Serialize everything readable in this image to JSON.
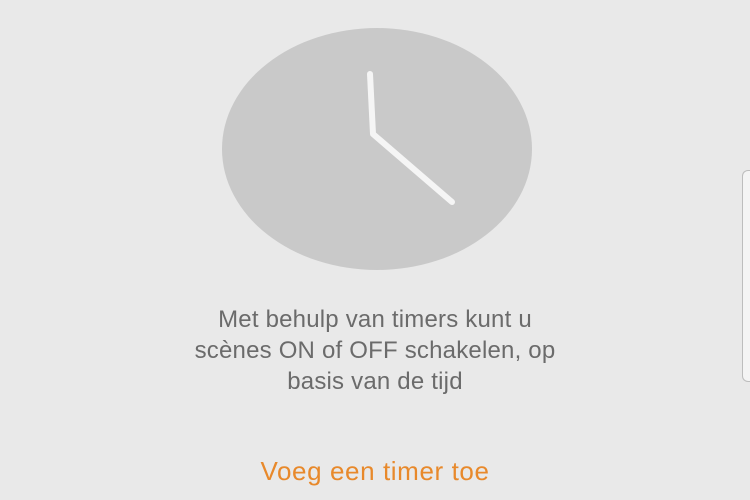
{
  "empty_state": {
    "icon": "clock-icon",
    "message_lines": [
      "Met behulp van timers kunt u",
      "scènes ON of OFF schakelen, op",
      "basis van de tijd"
    ]
  },
  "actions": {
    "add_timer_label": "Voeg een timer toe"
  },
  "colors": {
    "background": "#e9e9e9",
    "icon_fill": "#c9c9c9",
    "icon_hands": "#f5f5f5",
    "message_text": "#6b6b6b",
    "accent": "#e8892b"
  }
}
